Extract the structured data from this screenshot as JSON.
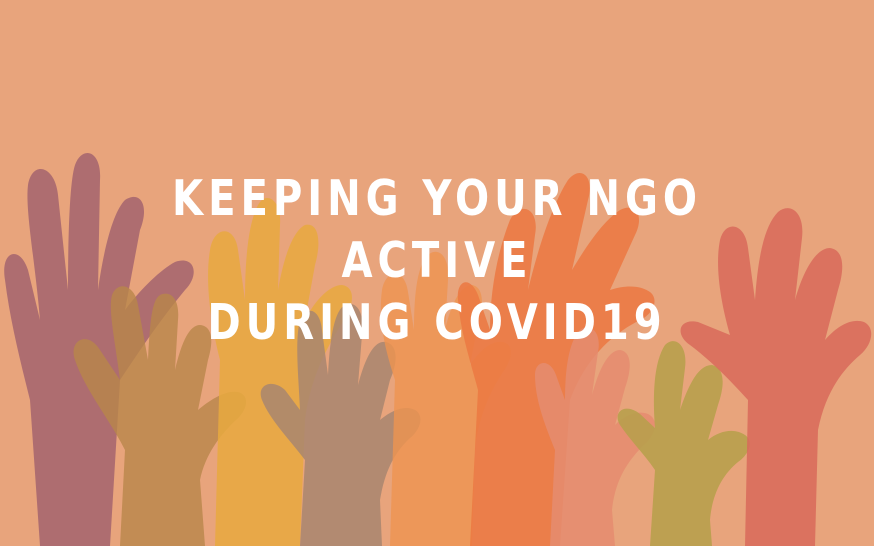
{
  "banner": {
    "headline_line1": "KEEPING YOUR NGO ACTIVE",
    "headline_line2": "DURING COVID19"
  },
  "colors": {
    "background": "#E8A47C",
    "hand_mauve": "#A3646F",
    "hand_ochre": "#C88A4A",
    "hand_gold": "#E6A23E",
    "hand_tan": "#B58A6A",
    "hand_orange": "#E87A40",
    "hand_coral": "#E2876A",
    "hand_olive": "#B9A24A",
    "hand_red": "#D86A5A",
    "text": "#FFFFFF"
  },
  "icons": [
    "raised-hands-illustration"
  ]
}
